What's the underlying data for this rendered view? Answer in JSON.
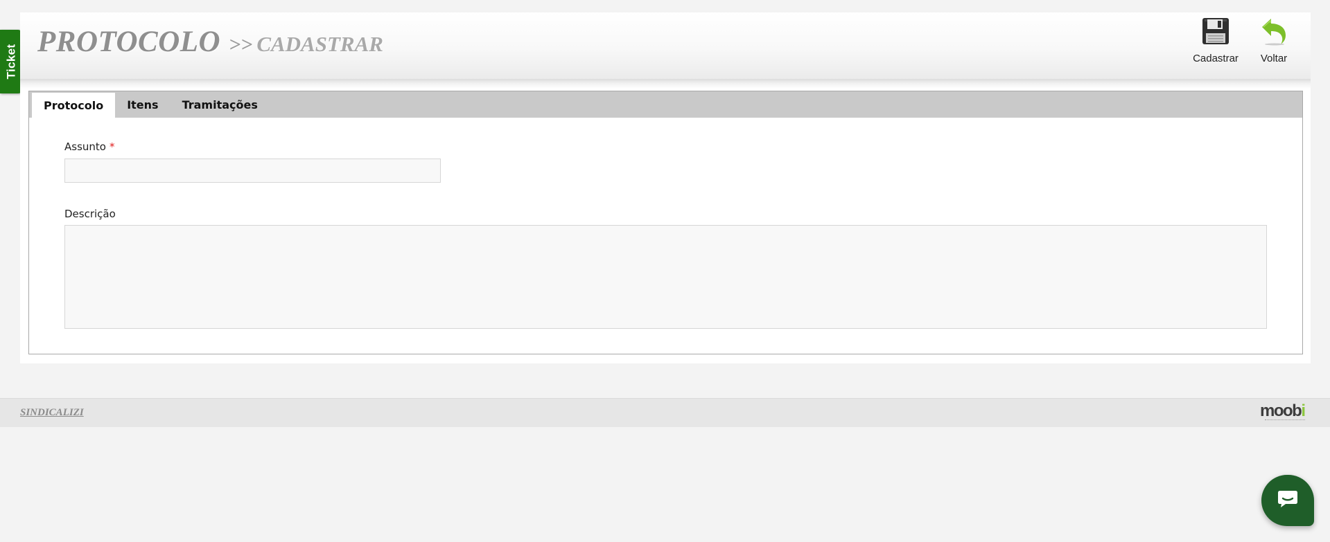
{
  "ticket_tab": {
    "label": "Ticket"
  },
  "header": {
    "title": "PROTOCOLO",
    "separator": ">>",
    "subtitle": "CADASTRAR"
  },
  "toolbar": {
    "save_label": "Cadastrar",
    "back_label": "Voltar",
    "save_icon": "floppy-disk-icon",
    "back_icon": "return-arrow-icon"
  },
  "tabs": [
    {
      "label": "Protocolo",
      "active": true
    },
    {
      "label": "Itens",
      "active": false
    },
    {
      "label": "Tramitações",
      "active": false
    }
  ],
  "form": {
    "assunto": {
      "label": "Assunto",
      "required_mark": "*",
      "value": "",
      "placeholder": ""
    },
    "descricao": {
      "label": "Descrição",
      "value": "",
      "placeholder": ""
    }
  },
  "footer": {
    "company_link": "SINDICALIZI",
    "logo": {
      "text_main": "moob",
      "text_accent": "i"
    }
  },
  "chat": {
    "icon": "chat-bubble-icon"
  },
  "colors": {
    "ticket_tab": "#1f7a14",
    "chat_button": "#1f5e29",
    "back_arrow": "#7dbf2a",
    "required": "#e02020",
    "logo_accent": "#8cc63f"
  }
}
